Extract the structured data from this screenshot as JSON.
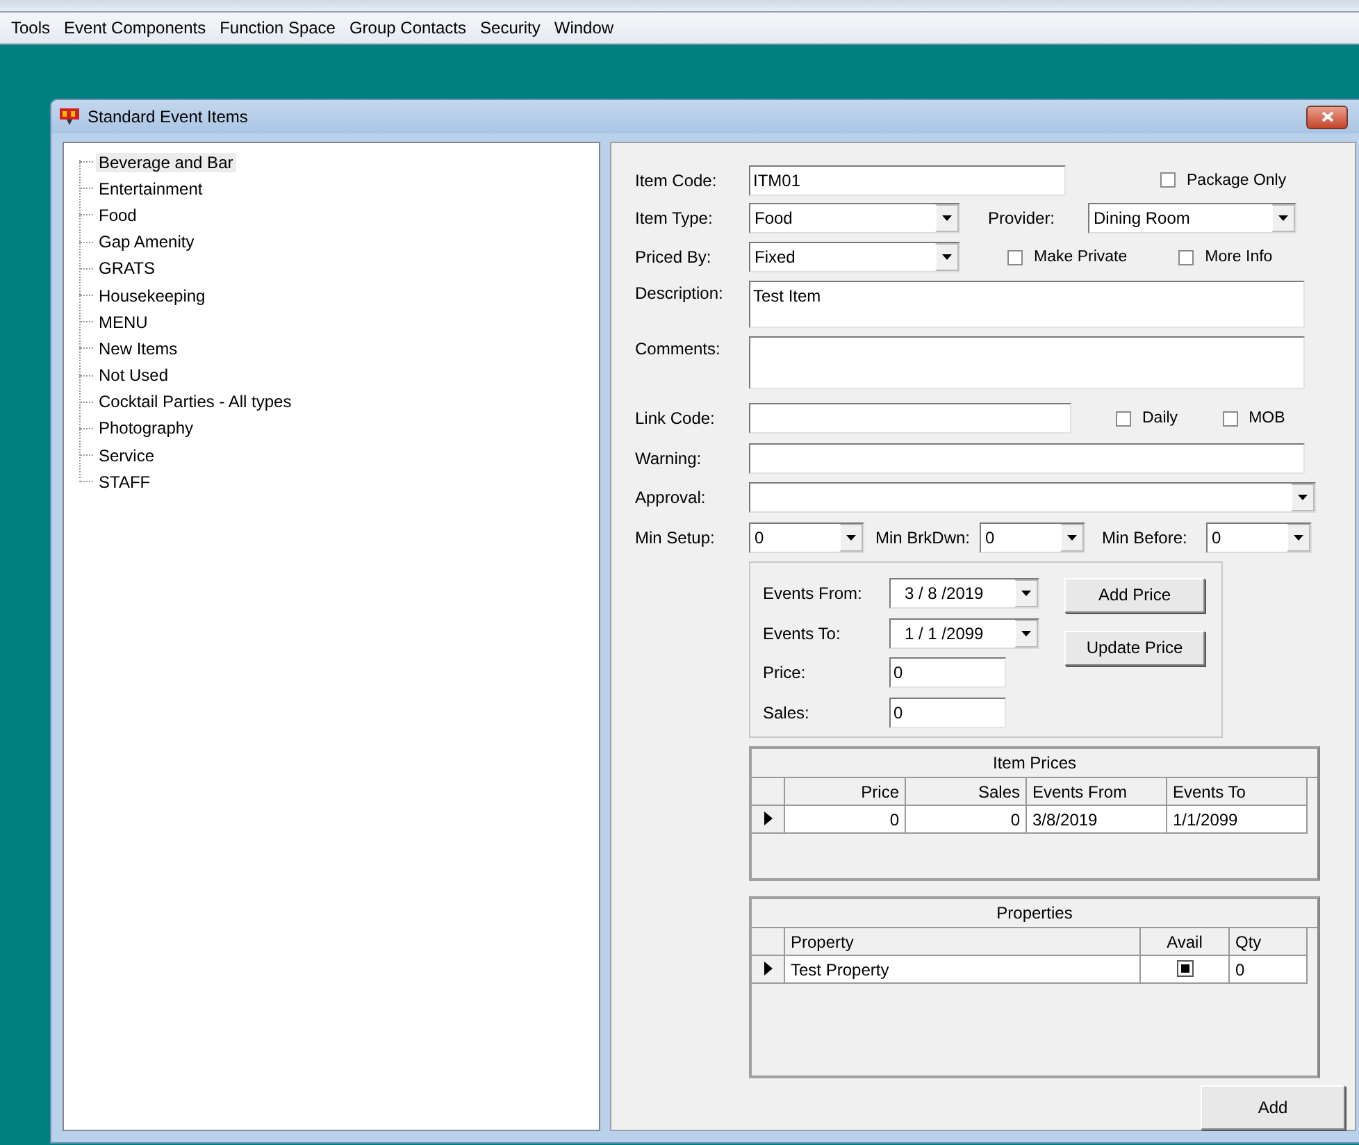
{
  "menu": [
    "Tools",
    "Event Components",
    "Function Space",
    "Group Contacts",
    "Security",
    "Window"
  ],
  "window": {
    "title": "Standard Event Items"
  },
  "tree": {
    "items": [
      {
        "label": "Beverage and Bar",
        "selected": true
      },
      {
        "label": "Entertainment",
        "selected": false
      },
      {
        "label": "Food",
        "selected": false
      },
      {
        "label": "Gap Amenity",
        "selected": false
      },
      {
        "label": "GRATS",
        "selected": false
      },
      {
        "label": "Housekeeping",
        "selected": false
      },
      {
        "label": "MENU",
        "selected": false
      },
      {
        "label": "New Items",
        "selected": false
      },
      {
        "label": "Not Used",
        "selected": false
      },
      {
        "label": "Cocktail Parties - All types",
        "selected": false
      },
      {
        "label": "Photography",
        "selected": false
      },
      {
        "label": "Service",
        "selected": false
      },
      {
        "label": "STAFF",
        "selected": false
      }
    ]
  },
  "form": {
    "item_code": {
      "label": "Item Code:",
      "value": "ITM01"
    },
    "package_only": {
      "label": "Package Only",
      "checked": false
    },
    "item_type": {
      "label": "Item Type:",
      "value": "Food"
    },
    "provider": {
      "label": "Provider:",
      "value": "Dining Room"
    },
    "priced_by": {
      "label": "Priced By:",
      "value": "Fixed"
    },
    "make_private": {
      "label": "Make Private",
      "checked": false
    },
    "more_info": {
      "label": "More Info",
      "checked": false
    },
    "description": {
      "label": "Description:",
      "value": "Test Item"
    },
    "comments": {
      "label": "Comments:"
    },
    "link_code": {
      "label": "Link Code:"
    },
    "daily": {
      "label": "Daily",
      "checked": false
    },
    "mob": {
      "label": "MOB",
      "checked": false
    },
    "warning": {
      "label": "Warning:"
    },
    "approval": {
      "label": "Approval:"
    },
    "min_setup": {
      "label": "Min Setup:",
      "value": "0"
    },
    "min_brkdwn": {
      "label": "Min BrkDwn:",
      "value": "0"
    },
    "min_before": {
      "label": "Min Before:",
      "value": "0"
    }
  },
  "price_panel": {
    "events_from": {
      "label": "Events From:",
      "value": "3 / 8 /2019"
    },
    "events_to": {
      "label": "Events To:",
      "value": "1 / 1 /2099"
    },
    "price": {
      "label": "Price:",
      "value": "0"
    },
    "sales": {
      "label": "Sales:",
      "value": "0"
    },
    "buttons": [
      "Add Price",
      "Update Price"
    ]
  },
  "item_prices": {
    "title": "Item Prices",
    "columns": [
      "Price",
      "Sales",
      "Events From",
      "Events To"
    ],
    "rows": [
      {
        "current": true,
        "cells": [
          "0",
          "0",
          "3/8/2019",
          "1/1/2099"
        ]
      }
    ]
  },
  "properties": {
    "title": "Properties",
    "columns": [
      "Property",
      "Avail",
      "Qty"
    ],
    "rows": [
      {
        "current": true,
        "property": "Test Property",
        "avail": true,
        "qty": "0"
      }
    ]
  },
  "add_button": "Add"
}
